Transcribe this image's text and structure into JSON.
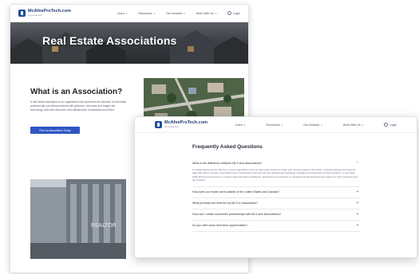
{
  "brand": {
    "name": "McAfeeProTech.com",
    "tagline": "by Lineserver"
  },
  "nav": {
    "links": [
      "Learn",
      "Resources",
      "Get Involved",
      "Work With Us"
    ],
    "login": "Login"
  },
  "hero": {
    "title": "Real Estate Associations"
  },
  "about": {
    "title": "What is an Association?",
    "text": "A real estate association is an organization that represents the interests of real estate professionals, providing members with guidance, resources and insight into technology, tools and resources, and maintenance of standards and ethics.",
    "button": "Find an Association Today"
  },
  "photos": {
    "aerial": "aerial neighborhood photo",
    "building": "REALTOR building photo",
    "building_sign": "REALTOR"
  },
  "faq": {
    "title": "Frequently Asked Questions",
    "items": [
      {
        "question": "What is the difference between MLS and associations?",
        "answer": "A multiple listing service (MLS) is a local organization used by real estate brokers to share and receive property information, including listings and property data with other members. Associations are organizations that promote the professional standards, education and advocacy of their members. In summary, while MLS services focus on property data and listing distribution, associations concentrate on professional development and support for their members and the industry.",
        "expanded": true
      },
      {
        "question": "How does our model work outside of the United States and Canada?",
        "expanded": false
      },
      {
        "question": "What products are best for my MLS or Association?",
        "expanded": false
      },
      {
        "question": "How can I create successful partnerships with MLS and Associations?",
        "expanded": false
      },
      {
        "question": "Do you offer some best term opportunities?",
        "expanded": false
      }
    ]
  },
  "colors": {
    "accent": "#2f55c4",
    "brand": "#1f4e9c"
  }
}
